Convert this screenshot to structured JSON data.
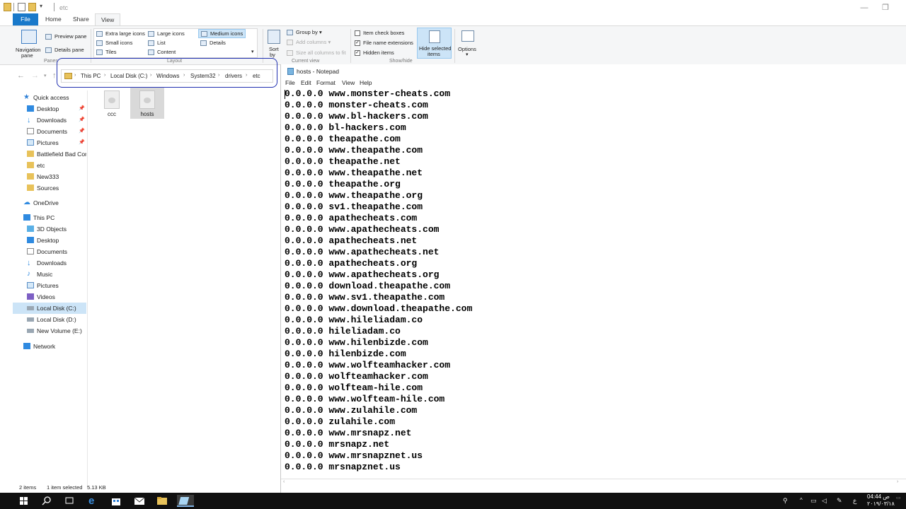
{
  "window": {
    "title": "etc"
  },
  "ribbon": {
    "tabs": [
      "File",
      "Home",
      "Share",
      "View"
    ],
    "panes": {
      "navigation_pane_line1": "Navigation",
      "navigation_pane_line2": "pane",
      "preview_pane": "Preview pane",
      "details_pane": "Details pane",
      "group_label": "Panes"
    },
    "layout": {
      "extra_large_icons": "Extra large icons",
      "large_icons": "Large icons",
      "medium_icons": "Medium icons",
      "small_icons": "Small icons",
      "list": "List",
      "details": "Details",
      "tiles": "Tiles",
      "content": "Content",
      "group_label": "Layout"
    },
    "current_view": {
      "sort_by_line1": "Sort",
      "sort_by_line2": "by",
      "group_by": "Group by",
      "add_columns": "Add columns",
      "size_all_columns": "Size all columns to fit",
      "group_label": "Current view"
    },
    "show_hide": {
      "item_check_boxes": "Item check boxes",
      "file_name_extensions": "File name extensions",
      "hidden_items": "Hidden items",
      "hide_selected_line1": "Hide selected",
      "hide_selected_line2": "items",
      "group_label": "Show/hide"
    },
    "options": "Options"
  },
  "address": {
    "crumbs": [
      "This PC",
      "Local Disk (C:)",
      "Windows",
      "System32",
      "drivers",
      "etc"
    ]
  },
  "sidebar": {
    "items": [
      {
        "label": "Quick access"
      },
      {
        "label": "Desktop"
      },
      {
        "label": "Downloads"
      },
      {
        "label": "Documents"
      },
      {
        "label": "Pictures"
      },
      {
        "label": "Battlefield Bad Com"
      },
      {
        "label": "etc"
      },
      {
        "label": "New333"
      },
      {
        "label": "Sources"
      },
      {
        "label": "OneDrive"
      },
      {
        "label": "This PC"
      },
      {
        "label": "3D Objects"
      },
      {
        "label": "Desktop"
      },
      {
        "label": "Documents"
      },
      {
        "label": "Downloads"
      },
      {
        "label": "Music"
      },
      {
        "label": "Pictures"
      },
      {
        "label": "Videos"
      },
      {
        "label": "Local Disk (C:)"
      },
      {
        "label": "Local Disk (D:)"
      },
      {
        "label": "New Volume (E:)"
      },
      {
        "label": "Network"
      }
    ]
  },
  "files": [
    {
      "name": "ccc"
    },
    {
      "name": "hosts"
    }
  ],
  "status": {
    "count": "2 items",
    "selected": "1 item selected",
    "size": "5.13 KB"
  },
  "notepad": {
    "title": "hosts - Notepad",
    "menu": [
      "File",
      "Edit",
      "Format",
      "View",
      "Help"
    ],
    "lines": [
      "0.0.0.0 www.monster-cheats.com",
      "0.0.0.0 monster-cheats.com",
      "0.0.0.0 www.bl-hackers.com",
      "0.0.0.0 bl-hackers.com",
      "0.0.0.0 theapathe.com",
      "0.0.0.0 www.theapathe.com",
      "0.0.0.0 theapathe.net",
      "0.0.0.0 www.theapathe.net",
      "0.0.0.0 theapathe.org",
      "0.0.0.0 www.theapathe.org",
      "0.0.0.0 sv1.theapathe.com",
      "0.0.0.0 apathecheats.com",
      "0.0.0.0 www.apathecheats.com",
      "0.0.0.0 apathecheats.net",
      "0.0.0.0 www.apathecheats.net",
      "0.0.0.0 apathecheats.org",
      "0.0.0.0 www.apathecheats.org",
      "0.0.0.0 download.theapathe.com",
      "0.0.0.0 www.sv1.theapathe.com",
      "0.0.0.0 www.download.theapathe.com",
      "0.0.0.0 www.hileliadam.co",
      "0.0.0.0 hileliadam.co",
      "0.0.0.0 www.hilenbizde.com",
      "0.0.0.0 hilenbizde.com",
      "0.0.0.0 www.wolfteamhacker.com",
      "0.0.0.0 wolfteamhacker.com",
      "0.0.0.0 wolfteam-hile.com",
      "0.0.0.0 www.wolfteam-hile.com",
      "0.0.0.0 www.zulahile.com",
      "0.0.0.0 zulahile.com",
      "0.0.0.0 www.mrsnapz.net",
      "0.0.0.0 mrsnapz.net",
      "0.0.0.0 www.mrsnapznet.us",
      "0.0.0.0 mrsnapznet.us"
    ]
  },
  "taskbar": {
    "time": "04:44 ص",
    "date": "٢٠١٩/٠٣/١٨",
    "lang": "ع"
  },
  "colors": {
    "accent": "#1979ca",
    "selection": "#cce4f7",
    "annotation": "#1f2fb0",
    "taskbar": "#101010"
  }
}
